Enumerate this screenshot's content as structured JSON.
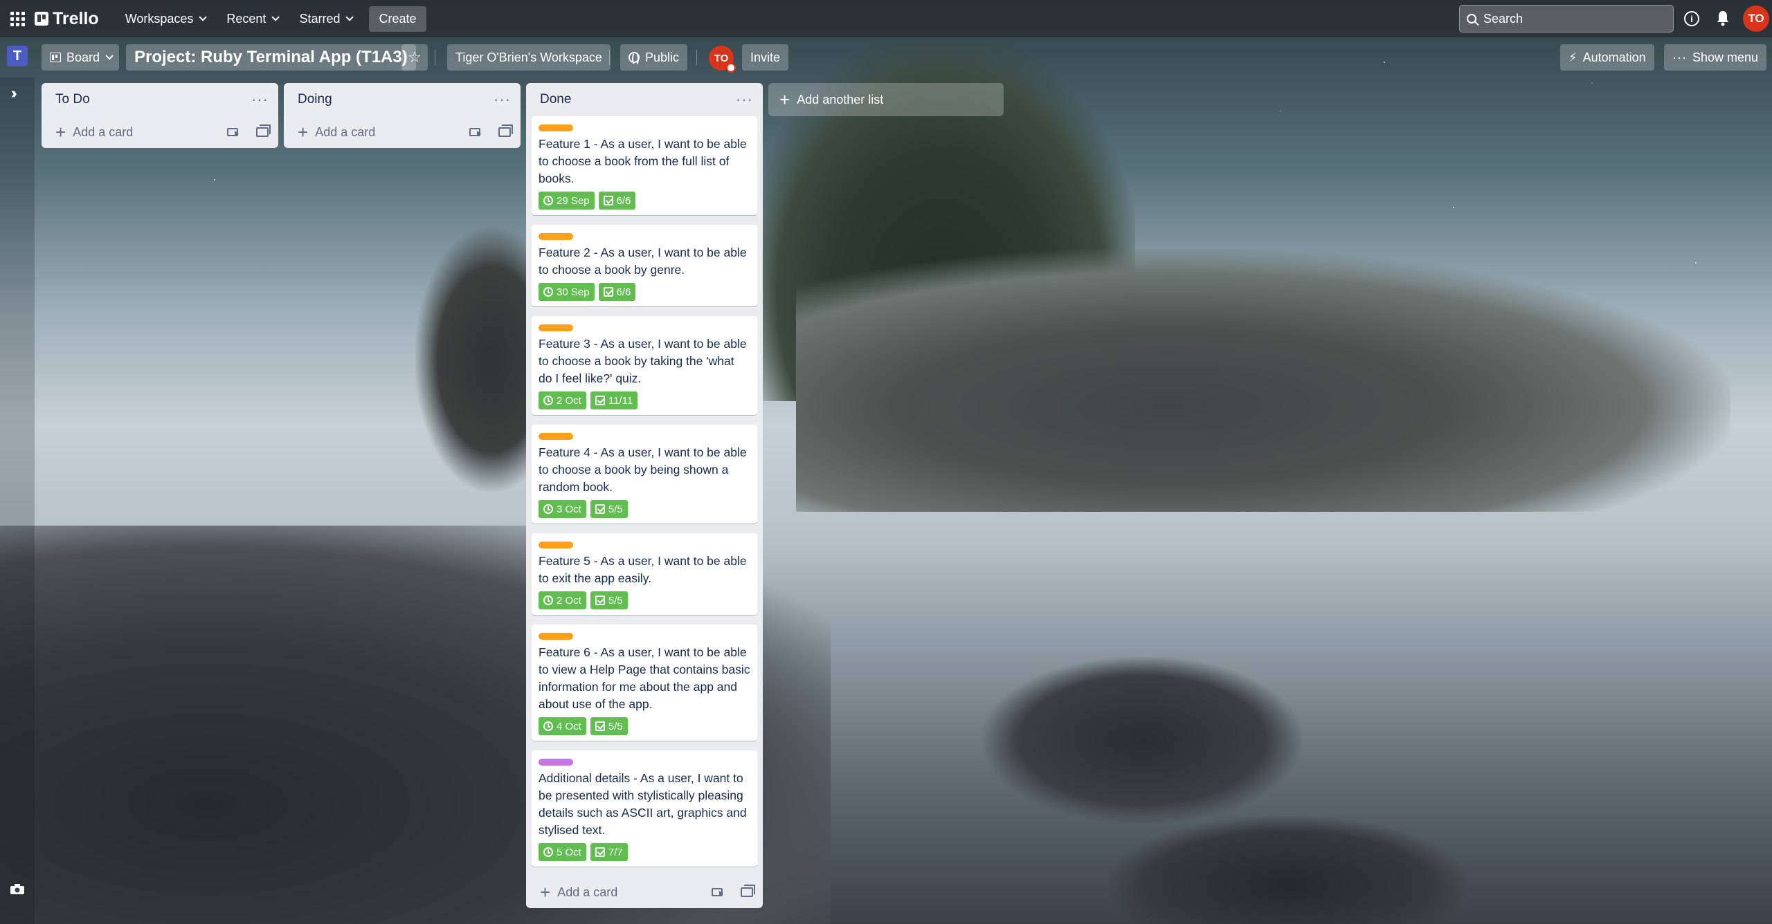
{
  "nav": {
    "logo": "Trello",
    "workspaces": "Workspaces",
    "recent": "Recent",
    "starred": "Starred",
    "create": "Create",
    "search_placeholder": "Search",
    "avatar_initials": "TO"
  },
  "board": {
    "view": "Board",
    "title": "Project: Ruby Terminal App (T1A3)",
    "workspace": "Tiger O'Brien's Workspace",
    "visibility": "Public",
    "invite": "Invite",
    "automation": "Automation",
    "show_menu": "Show menu",
    "workspace_initial": "T",
    "member_initials": "TO"
  },
  "lists": [
    {
      "title": "To Do",
      "add_card": "Add a card"
    },
    {
      "title": "Doing",
      "add_card": "Add a card"
    },
    {
      "title": "Done",
      "add_card": "Add a card",
      "cards": [
        {
          "label_color": "#ff9f1a",
          "text": "Feature 1 - As a user, I want to be able to choose a book from the full list of books.",
          "due": "29 Sep",
          "checklist": "6/6"
        },
        {
          "label_color": "#ff9f1a",
          "text": "Feature 2 - As a user, I want to be able to choose a book by genre.",
          "due": "30 Sep",
          "checklist": "6/6"
        },
        {
          "label_color": "#ff9f1a",
          "text": "Feature 3 - As a user, I want to be able to choose a book by taking the 'what do I feel like?' quiz.",
          "due": "2 Oct",
          "checklist": "11/11"
        },
        {
          "label_color": "#ff9f1a",
          "text": "Feature 4 - As a user, I want to be able to choose a book by being shown a random book.",
          "due": "3 Oct",
          "checklist": "5/5"
        },
        {
          "label_color": "#ff9f1a",
          "text": "Feature 5 - As a user, I want to be able to exit the app easily.",
          "due": "2 Oct",
          "checklist": "5/5"
        },
        {
          "label_color": "#ff9f1a",
          "text": "Feature 6 - As a user, I want to be able to view a Help Page that contains basic information for me about the app and about use of the app.",
          "due": "4 Oct",
          "checklist": "5/5"
        },
        {
          "label_color": "#c377e0",
          "text": "Additional details - As a user, I want to be presented with stylistically pleasing details such as ASCII art, graphics and stylised text.",
          "due": "5 Oct",
          "checklist": "7/7"
        }
      ]
    }
  ],
  "add_list": "Add another list",
  "colors": {
    "badge_complete": "#61bd4f",
    "avatar": "#d9331b",
    "workspace_tile": "#4b5cc4"
  }
}
